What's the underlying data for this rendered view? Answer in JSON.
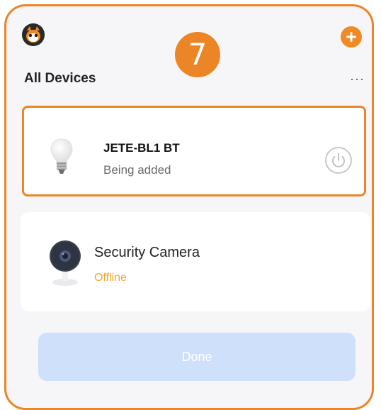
{
  "step_badge": "7",
  "header": {
    "title": "All Devices",
    "more_label": "···"
  },
  "devices": [
    {
      "name": "JETE-BL1 BT",
      "status": "Being added",
      "icon": "light-bulb-icon",
      "highlighted": true
    },
    {
      "name": "Security Camera",
      "status": "Offline",
      "icon": "camera-icon"
    }
  ],
  "footer": {
    "done_label": "Done"
  },
  "colors": {
    "accent": "#ec8526",
    "add_button": "#f08a24",
    "offline": "#f5a623",
    "done_disabled": "#cfe0fb"
  }
}
